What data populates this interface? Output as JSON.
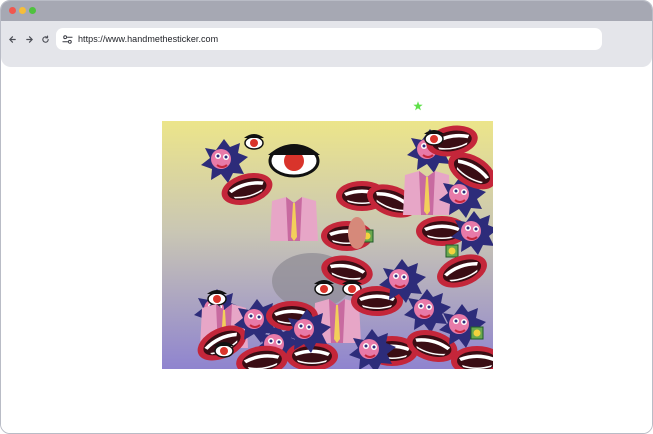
{
  "browser": {
    "url": "https://www.handmethesticker.com",
    "buttons": {
      "back": "back-arrow-icon",
      "forward": "forward-arrow-icon",
      "reload": "reload-icon"
    },
    "site_icon": "site-settings-icon"
  },
  "page": {
    "decoration": "green-star-icon",
    "artwork": {
      "description_icon": "sticker-collage-image"
    }
  },
  "colors": {
    "titlebar": "#a6a8b3",
    "toolbar": "#e4e5ea",
    "star": "#5fe04a",
    "artwork_top": "#ece58a",
    "artwork_bottom": "#8f84cf",
    "lips": "#c4263a",
    "navy": "#2d2c7a",
    "pink": "#e87aa8"
  }
}
